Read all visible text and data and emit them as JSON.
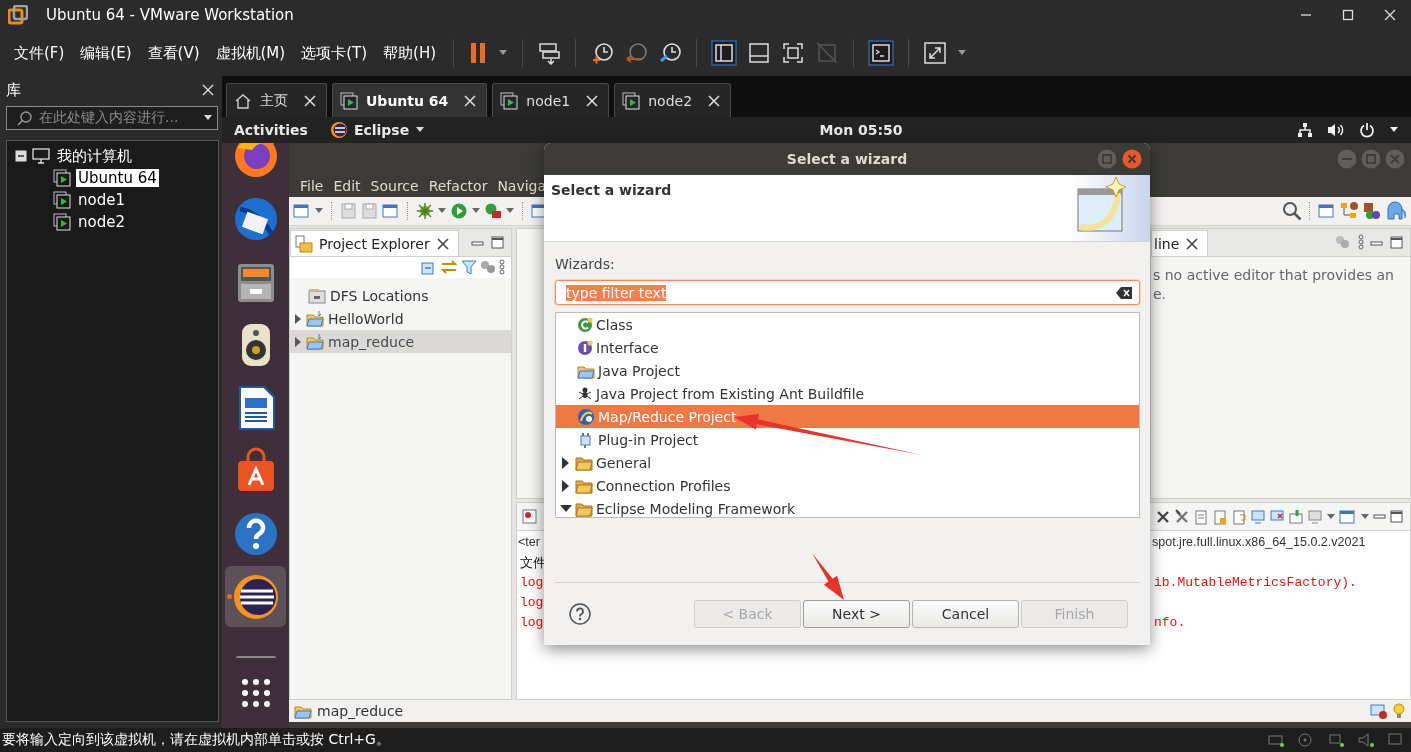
{
  "vmware": {
    "title": "Ubuntu 64 - VMware Workstation",
    "menus": [
      "文件(F)",
      "编辑(E)",
      "查看(V)",
      "虚拟机(M)",
      "选项卡(T)",
      "帮助(H)"
    ],
    "library": {
      "title": "库",
      "search_placeholder": "在此处键入内容进行...",
      "tree": [
        {
          "label": "我的计算机",
          "expanded": true,
          "selected": false,
          "children": [
            {
              "label": "Ubuntu 64",
              "selected": true
            },
            {
              "label": "node1",
              "selected": false
            },
            {
              "label": "node2",
              "selected": false
            }
          ]
        }
      ]
    },
    "tabs": [
      {
        "label": "主页",
        "kind": "home",
        "selected": false
      },
      {
        "label": "Ubuntu 64",
        "kind": "vm",
        "selected": true
      },
      {
        "label": "node1",
        "kind": "vm",
        "selected": false
      },
      {
        "label": "node2",
        "kind": "vm",
        "selected": false
      }
    ],
    "status_bar": "要将输入定向到该虚拟机，请在虚拟机内部单击或按 Ctrl+G。"
  },
  "ubuntu": {
    "activities": "Activities",
    "app_menu": "Eclipse",
    "clock": "Mon 05:50",
    "dock": [
      {
        "kind": "browser",
        "active": false
      },
      {
        "kind": "mail",
        "active": false
      },
      {
        "kind": "files",
        "active": false
      },
      {
        "kind": "speaker",
        "active": false
      },
      {
        "kind": "writer",
        "active": false
      },
      {
        "kind": "store",
        "active": false
      },
      {
        "kind": "help",
        "active": false
      },
      {
        "kind": "ide",
        "active": true
      },
      {
        "kind": "blank",
        "active": false
      }
    ]
  },
  "eclipse": {
    "menus": [
      "File",
      "Edit",
      "Source",
      "Refactor",
      "Naviga"
    ],
    "project_explorer": {
      "title": "Project Explorer",
      "items": [
        {
          "label": "DFS Locations",
          "kind": "dfs",
          "selected": false
        },
        {
          "label": "HelloWorld",
          "kind": "project",
          "selected": false
        },
        {
          "label": "map_reduce",
          "kind": "project",
          "selected": true
        }
      ]
    },
    "outline": {
      "tab": "line",
      "message": "s no active editor that provides an",
      "message_2": "e."
    },
    "console": {
      "header_left": "<ter",
      "header_right": "spot.jre.full.linux.x86_64_15.0.2.v2021",
      "lines": [
        {
          "kind": "normal",
          "text": "文件"
        },
        {
          "kind": "error",
          "text": "log",
          "tail": "ib.MutableMetricsFactory)."
        },
        {
          "kind": "error",
          "text": "log"
        },
        {
          "kind": "error",
          "text": "log",
          "tail": "nfo."
        }
      ]
    },
    "status": "map_reduce"
  },
  "wizard": {
    "window_title": "Select a wizard",
    "heading": "Select a wizard",
    "label": "Wizards:",
    "filter": {
      "value": "type filter text"
    },
    "items": [
      {
        "label": "Class",
        "kind": "class",
        "selected": false
      },
      {
        "label": "Interface",
        "kind": "interface",
        "selected": false
      },
      {
        "label": "Java Project",
        "kind": "java-project",
        "selected": false
      },
      {
        "label": "Java Project from Existing Ant Buildfile",
        "kind": "ant",
        "selected": false
      },
      {
        "label": "Map/Reduce Project",
        "kind": "mapreduce",
        "selected": true
      },
      {
        "label": "Plug-in Project",
        "kind": "plugin",
        "selected": false
      },
      {
        "label": "General",
        "kind": "folder",
        "expanded": false,
        "selected": false
      },
      {
        "label": "Connection Profiles",
        "kind": "folder",
        "expanded": false,
        "selected": false
      },
      {
        "label": "Eclipse Modeling Framework",
        "kind": "folder",
        "expanded": true,
        "selected": false
      }
    ],
    "buttons": [
      {
        "label": "< Back",
        "kind": "back",
        "disabled": true
      },
      {
        "label": "Next >",
        "kind": "next",
        "disabled": false
      },
      {
        "label": "Cancel",
        "kind": "cancel",
        "disabled": false
      },
      {
        "label": "Finish",
        "kind": "finish",
        "disabled": true
      }
    ]
  }
}
